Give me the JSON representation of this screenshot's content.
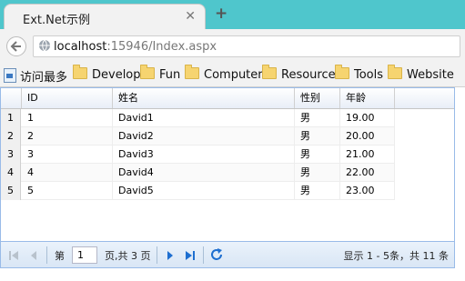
{
  "browser": {
    "tab_title": "Ext.Net示例",
    "tab_close": "✕",
    "new_tab": "+",
    "url_host": "localhost",
    "url_rest": ":15946/Index.aspx"
  },
  "bookmarks": [
    {
      "label": "访问最多",
      "icon": "page-icon"
    },
    {
      "label": "Develop",
      "icon": "folder-icon"
    },
    {
      "label": "Fun",
      "icon": "folder-icon"
    },
    {
      "label": "Computer",
      "icon": "folder-icon"
    },
    {
      "label": "Resource",
      "icon": "folder-icon"
    },
    {
      "label": "Tools",
      "icon": "folder-icon"
    },
    {
      "label": "Website",
      "icon": "folder-icon"
    }
  ],
  "grid": {
    "columns": [
      "ID",
      "姓名",
      "性别",
      "年龄"
    ],
    "rows": [
      {
        "num": "1",
        "id": "1",
        "name": "David1",
        "gender": "男",
        "age": "19.00"
      },
      {
        "num": "2",
        "id": "2",
        "name": "David2",
        "gender": "男",
        "age": "20.00"
      },
      {
        "num": "3",
        "id": "3",
        "name": "David3",
        "gender": "男",
        "age": "21.00"
      },
      {
        "num": "4",
        "id": "4",
        "name": "David4",
        "gender": "男",
        "age": "22.00"
      },
      {
        "num": "5",
        "id": "5",
        "name": "David5",
        "gender": "男",
        "age": "23.00"
      }
    ]
  },
  "pager": {
    "page_prefix": "第",
    "page_value": "1",
    "page_suffix": "页,共 3 页",
    "display_info": "显示 1 - 5条，共 11 条"
  },
  "colors": {
    "tab_strip": "#4fc6cc",
    "grid_border": "#99bbe8",
    "accent_icon": "#1e6fd0"
  }
}
